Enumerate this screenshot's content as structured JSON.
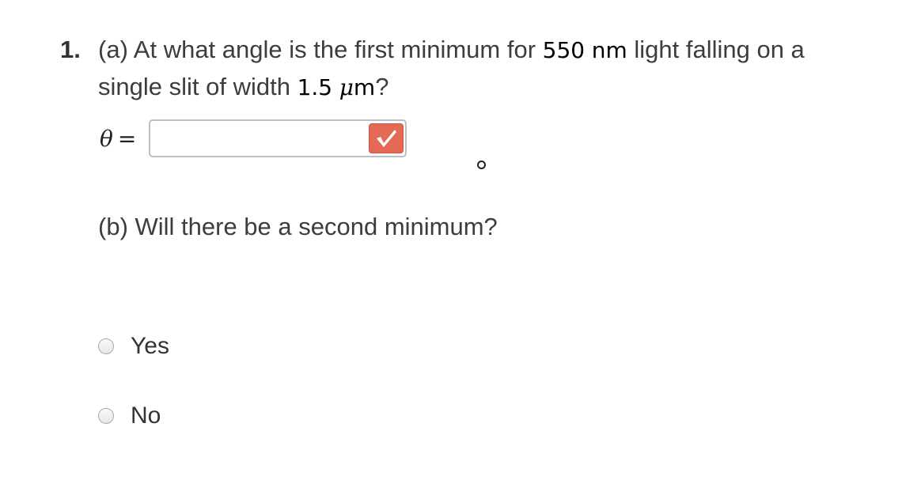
{
  "question": {
    "number": "1.",
    "part_a": {
      "prefix": "(a) At what angle is the first minimum for ",
      "wavelength_value": "550",
      "wavelength_unit": "nm",
      "middle": " light falling on a single slit of width ",
      "width_value": "1.5",
      "width_unit_mu": "μ",
      "width_unit_m": "m",
      "suffix": "?"
    },
    "answer": {
      "variable": "θ",
      "equals": "=",
      "input_value": "",
      "degree_symbol": "°"
    },
    "part_b": {
      "text": "(b) Will there be a second minimum?"
    },
    "options": [
      {
        "label": "Yes",
        "selected": false
      },
      {
        "label": "No",
        "selected": false
      }
    ]
  },
  "colors": {
    "check_button": "#e46a55",
    "text": "#3d3d3d",
    "input_border": "#b9c1c8"
  },
  "icons": {
    "check_button": "checkmark-icon"
  }
}
